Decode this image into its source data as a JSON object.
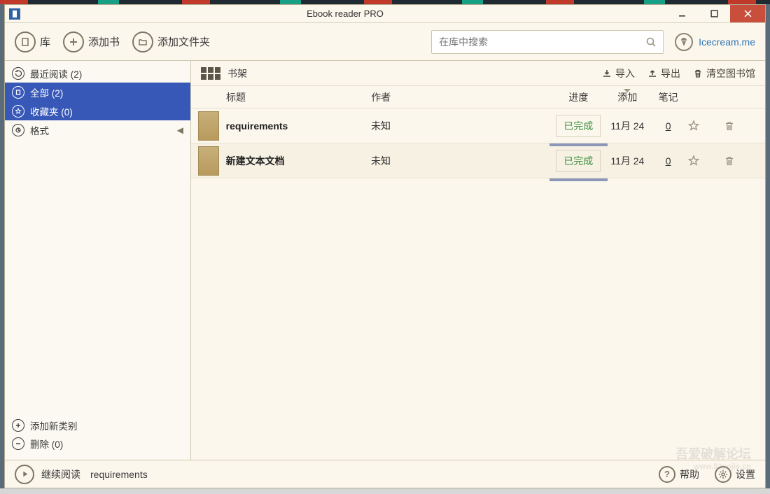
{
  "window": {
    "title": "Ebook reader PRO"
  },
  "toolbar": {
    "library": "库",
    "add_book": "添加书",
    "add_folder": "添加文件夹"
  },
  "search": {
    "placeholder": "在库中搜索"
  },
  "brand": {
    "label": "Icecream.me"
  },
  "sidebar": {
    "items": [
      {
        "label": "最近阅读  (2)"
      },
      {
        "label": "全部  (2)"
      },
      {
        "label": "收藏夹  (0)"
      },
      {
        "label": "格式"
      }
    ],
    "add_category": "添加新类别",
    "delete": "删除  (0)"
  },
  "shelf": {
    "title": "书架",
    "import": "导入",
    "export": "导出",
    "clear": "清空图书馆"
  },
  "columns": {
    "title": "标题",
    "author": "作者",
    "progress": "进度",
    "added": "添加",
    "notes": "笔记"
  },
  "books": [
    {
      "title": "requirements",
      "author": "未知",
      "progress": "已完成",
      "added": "11月 24",
      "notes": "0"
    },
    {
      "title": "新建文本文档",
      "author": "未知",
      "progress": "已完成",
      "added": "11月 24",
      "notes": "0"
    }
  ],
  "footer": {
    "continue": "继续阅读",
    "current": "requirements",
    "help": "帮助",
    "settings": "设置"
  },
  "watermark": {
    "line1": "吾爱破解论坛",
    "line2": "www.52pojie.cn"
  }
}
